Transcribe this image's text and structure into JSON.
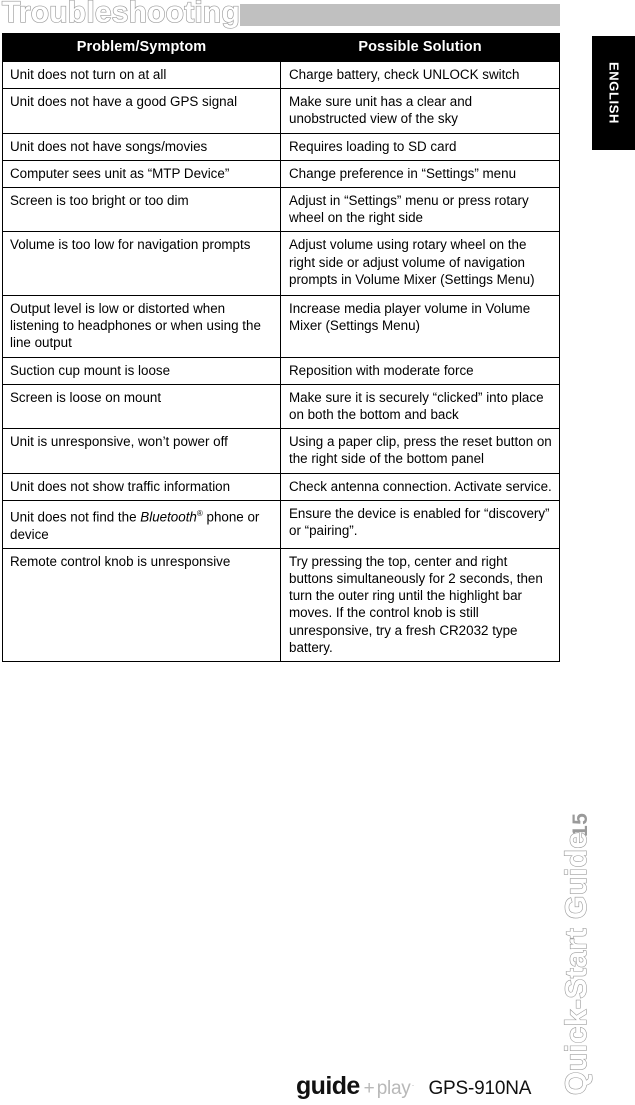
{
  "page": {
    "title": "Troubleshooting",
    "language_tab": "ENGLISH",
    "page_number": "15",
    "guide_label": "Quick-Start Guide",
    "accent_gray": "#c0c0c0",
    "outline_gray": "#9a9a9a",
    "header_bg": "#000000"
  },
  "table": {
    "headers": {
      "problem": "Problem/Symptom",
      "solution": "Possible Solution"
    },
    "rows": [
      {
        "problem": "Unit does not turn on at all",
        "solution": "Charge battery, check UNLOCK switch"
      },
      {
        "problem": "Unit does not have a good GPS signal",
        "solution": "Make sure unit has a clear and unobstructed view of the sky"
      },
      {
        "problem": "Unit does not have songs/movies",
        "solution": "Requires loading to SD card"
      },
      {
        "problem": "Computer sees unit as “MTP Device”",
        "solution": "Change preference in “Settings” menu"
      },
      {
        "problem": "Screen is too bright or too dim",
        "solution": "Adjust in “Settings” menu or press rotary wheel on the right side"
      },
      {
        "problem": "Volume is too low for navigation prompts",
        "solution": "Adjust volume using rotary wheel on the right side or adjust volume of navigation prompts in Volume Mixer (Settings Menu)"
      },
      {
        "problem": "Output level is low or distorted when listening to headphones or when using the line output",
        "solution": "Increase media player volume in Volume Mixer (Settings Menu)"
      },
      {
        "problem": "Suction cup mount is loose",
        "solution": "Reposition with moderate force"
      },
      {
        "problem": "Screen is loose on mount",
        "solution": "Make sure it is securely  “clicked”  into place on both the bottom and back"
      },
      {
        "problem": "Unit is unresponsive, won’t power off",
        "solution": "Using a paper clip, press the reset button on the right side of the bottom panel"
      },
      {
        "problem": "Unit does not show traffic information",
        "solution": "Check antenna connection. Activate service."
      },
      {
        "problem_prefix": "Unit does not find the ",
        "problem_italic": "Bluetooth",
        "problem_sup": "®",
        "problem_suffix": " phone or device",
        "solution": "Ensure the device is enabled for “discovery” or “pairing”."
      },
      {
        "problem": "Remote control knob is unresponsive",
        "solution": "Try pressing the top, center and right buttons simultaneously for 2 seconds, then turn the outer ring until the highlight bar moves. If the control knob is still unresponsive, try a fresh CR2032 type battery."
      }
    ]
  },
  "footer": {
    "logo_guide": "guide",
    "logo_plus": "+",
    "logo_play": "play",
    "logo_tm": "·",
    "model": "GPS-910NA"
  }
}
